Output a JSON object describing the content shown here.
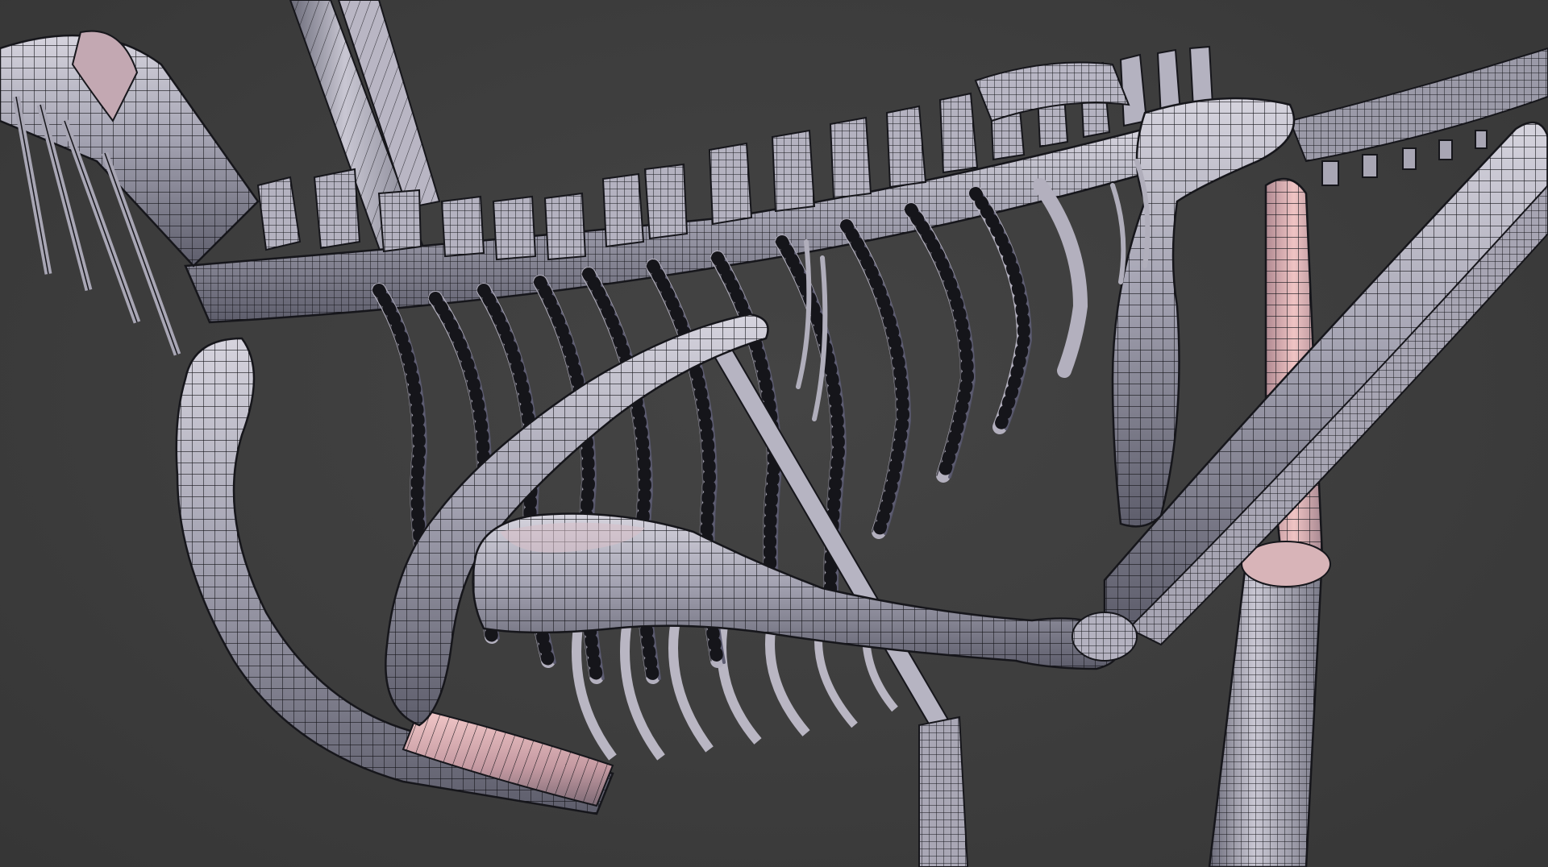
{
  "viewport": {
    "background_color": "#3d3d3d",
    "subject": "skeleton-wireframe-render"
  },
  "colors": {
    "bone_base": "#9c9cab",
    "bone_light": "#d4d2dc",
    "bone_shadow": "#5e5e6c",
    "bone_warm": "#e6b4b4",
    "wire": "#141418"
  }
}
